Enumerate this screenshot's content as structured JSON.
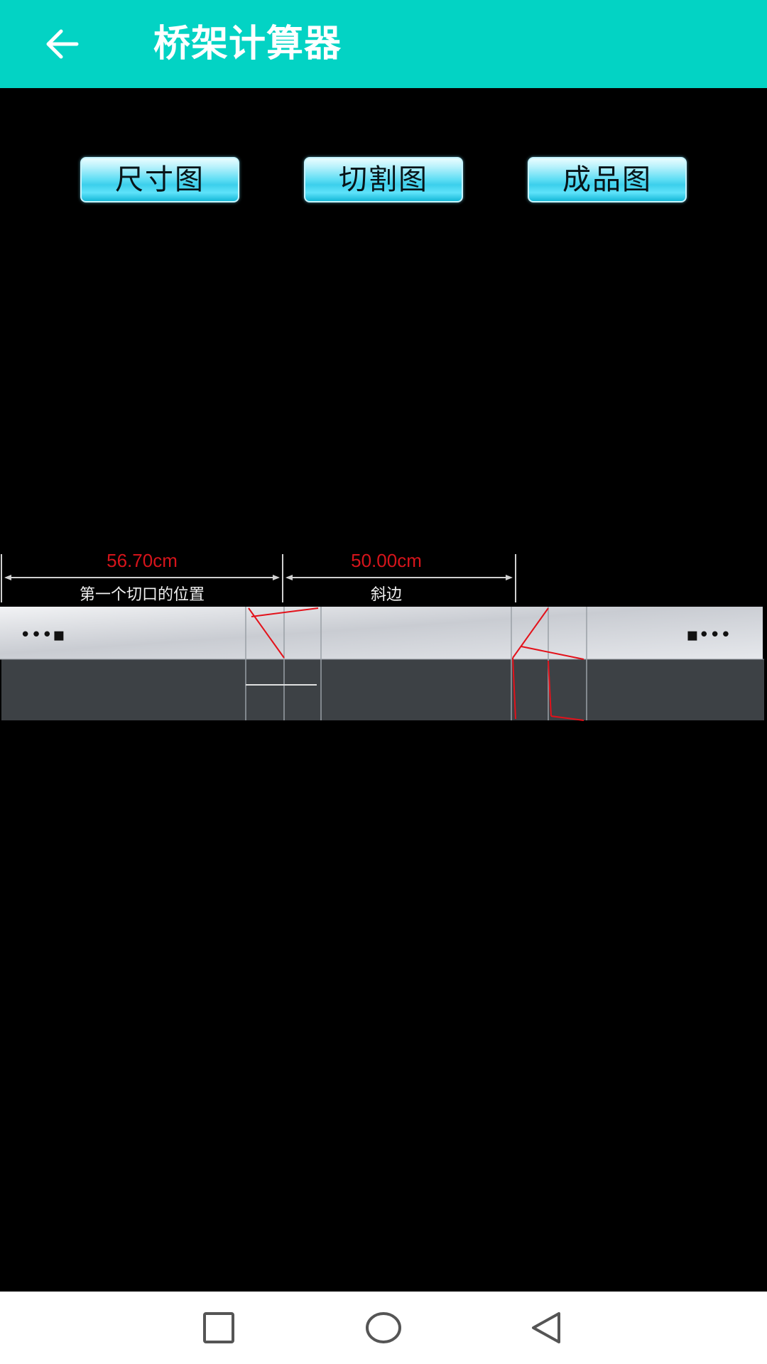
{
  "app_bar": {
    "title": "桥架计算器",
    "back_icon": "arrow-left-icon",
    "color": "#03d3c4"
  },
  "tabs": [
    {
      "label": "尺寸图"
    },
    {
      "label": "切割图"
    },
    {
      "label": "成品图"
    }
  ],
  "diagram": {
    "dimension_1": {
      "value": "56.70cm",
      "caption": "第一个切口的位置"
    },
    "dimension_2": {
      "value": "50.00cm",
      "caption": "斜边"
    },
    "left_marker": "•••▪",
    "right_marker": "▪•••",
    "value_color": "#d6141b"
  },
  "nav_bar": {
    "recent_icon": "square-icon",
    "home_icon": "circle-icon",
    "back_icon": "triangle-back-icon"
  }
}
